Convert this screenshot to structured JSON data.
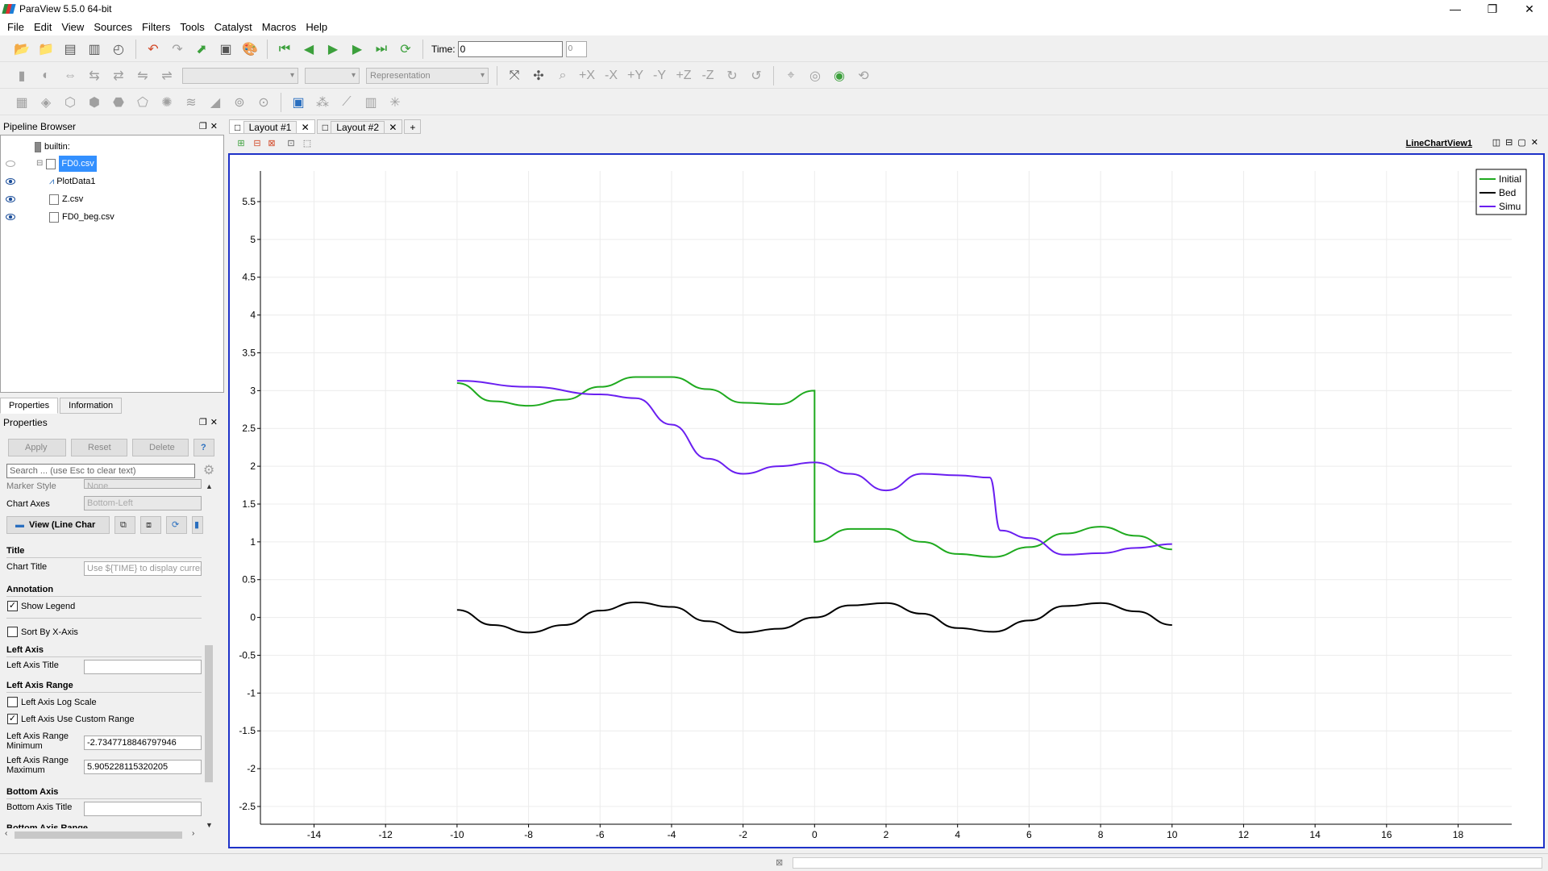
{
  "app": {
    "title": "ParaView 5.5.0 64-bit"
  },
  "menu": [
    "File",
    "Edit",
    "View",
    "Sources",
    "Filters",
    "Tools",
    "Catalyst",
    "Macros",
    "Help"
  ],
  "toolbar": {
    "time_label": "Time:",
    "time_value": "0",
    "time_step": "0",
    "representation": "Representation"
  },
  "pipeline": {
    "title": "Pipeline Browser",
    "root": "builtin:",
    "items": [
      "FD0.csv",
      "PlotData1",
      "Z.csv",
      "FD0_beg.csv"
    ]
  },
  "tabs": {
    "properties": "Properties",
    "information": "Information"
  },
  "properties": {
    "title": "Properties",
    "apply": "Apply",
    "reset": "Reset",
    "delete": "Delete",
    "help": "?",
    "search_placeholder": "Search ... (use Esc to clear text)",
    "marker_style_label": "Marker Style",
    "marker_style_value": "None",
    "chart_axes_label": "Chart Axes",
    "chart_axes_value": "Bottom-Left",
    "view_button": "View (Line Char",
    "title_section": "Title",
    "chart_title_label": "Chart Title",
    "chart_title_placeholder": "Use ${TIME} to display curren",
    "annotation_section": "Annotation",
    "show_legend": "Show Legend",
    "sort_by_x": "Sort By X-Axis",
    "left_axis_section": "Left Axis",
    "left_axis_title_label": "Left Axis Title",
    "left_axis_range_section": "Left Axis Range",
    "left_axis_log": "Left Axis Log Scale",
    "left_axis_custom": "Left Axis Use Custom Range",
    "left_min_label_1": "Left Axis Range",
    "left_min_label_2": "Minimum",
    "left_min_value": "-2.7347718846797946",
    "left_max_label_1": "Left Axis Range",
    "left_max_label_2": "Maximum",
    "left_max_value": "5.905228115320205",
    "bottom_axis_section": "Bottom Axis",
    "bottom_axis_title_label": "Bottom Axis Title",
    "bottom_axis_range_section": "Bottom Axis Range"
  },
  "layout_tabs": [
    "Layout #1",
    "Layout #2",
    "+"
  ],
  "view": {
    "name": "LineChartView1"
  },
  "colors": {
    "initial": "#1faa1f",
    "bed": "#000000",
    "simu": "#6a1ff0",
    "frame": "#1e32c8"
  },
  "chart_data": {
    "type": "line",
    "title": "",
    "xlabel": "",
    "ylabel": "",
    "xlim": [
      -15.5,
      19.5
    ],
    "ylim": [
      -2.7347718846797946,
      5.905228115320205
    ],
    "xticks": [
      -14,
      -12,
      -10,
      -8,
      -6,
      -4,
      -2,
      0,
      2,
      4,
      6,
      8,
      10,
      12,
      14,
      16,
      18
    ],
    "yticks": [
      -2.5,
      -2,
      -1.5,
      -1,
      -0.5,
      0,
      0.5,
      1,
      1.5,
      2,
      2.5,
      3,
      3.5,
      4,
      4.5,
      5,
      5.5
    ],
    "legend": "top-right",
    "series": [
      {
        "name": "Initial",
        "x": [
          -10,
          -9,
          -8,
          -7,
          -6,
          -5,
          -4,
          -3,
          -2,
          -1,
          0,
          0,
          1,
          2,
          3,
          4,
          5,
          6,
          7,
          8,
          9,
          10
        ],
        "y": [
          3.1,
          2.86,
          2.8,
          2.88,
          3.05,
          3.18,
          3.18,
          3.02,
          2.84,
          2.82,
          3.0,
          1.0,
          1.17,
          1.17,
          1.0,
          0.84,
          0.8,
          0.93,
          1.11,
          1.2,
          1.08,
          0.9
        ]
      },
      {
        "name": "Bed",
        "x": [
          -10,
          -9,
          -8,
          -7,
          -6,
          -5,
          -4,
          -3,
          -2,
          -1,
          0,
          1,
          2,
          3,
          4,
          5,
          6,
          7,
          8,
          9,
          10
        ],
        "y": [
          0.1,
          -0.1,
          -0.2,
          -0.1,
          0.09,
          0.2,
          0.14,
          -0.05,
          -0.2,
          -0.15,
          0.0,
          0.16,
          0.19,
          0.05,
          -0.14,
          -0.19,
          -0.04,
          0.15,
          0.19,
          0.08,
          -0.1
        ]
      },
      {
        "name": "Simu",
        "x": [
          -10,
          -8,
          -6,
          -5,
          -4,
          -3,
          -2,
          -1,
          0,
          1,
          2,
          3,
          4,
          4.9,
          5.2,
          6,
          7,
          8,
          9,
          10
        ],
        "y": [
          3.13,
          3.05,
          2.95,
          2.9,
          2.55,
          2.1,
          1.9,
          2.0,
          2.05,
          1.9,
          1.68,
          1.9,
          1.88,
          1.85,
          1.15,
          1.05,
          0.83,
          0.85,
          0.92,
          0.97
        ]
      }
    ]
  }
}
